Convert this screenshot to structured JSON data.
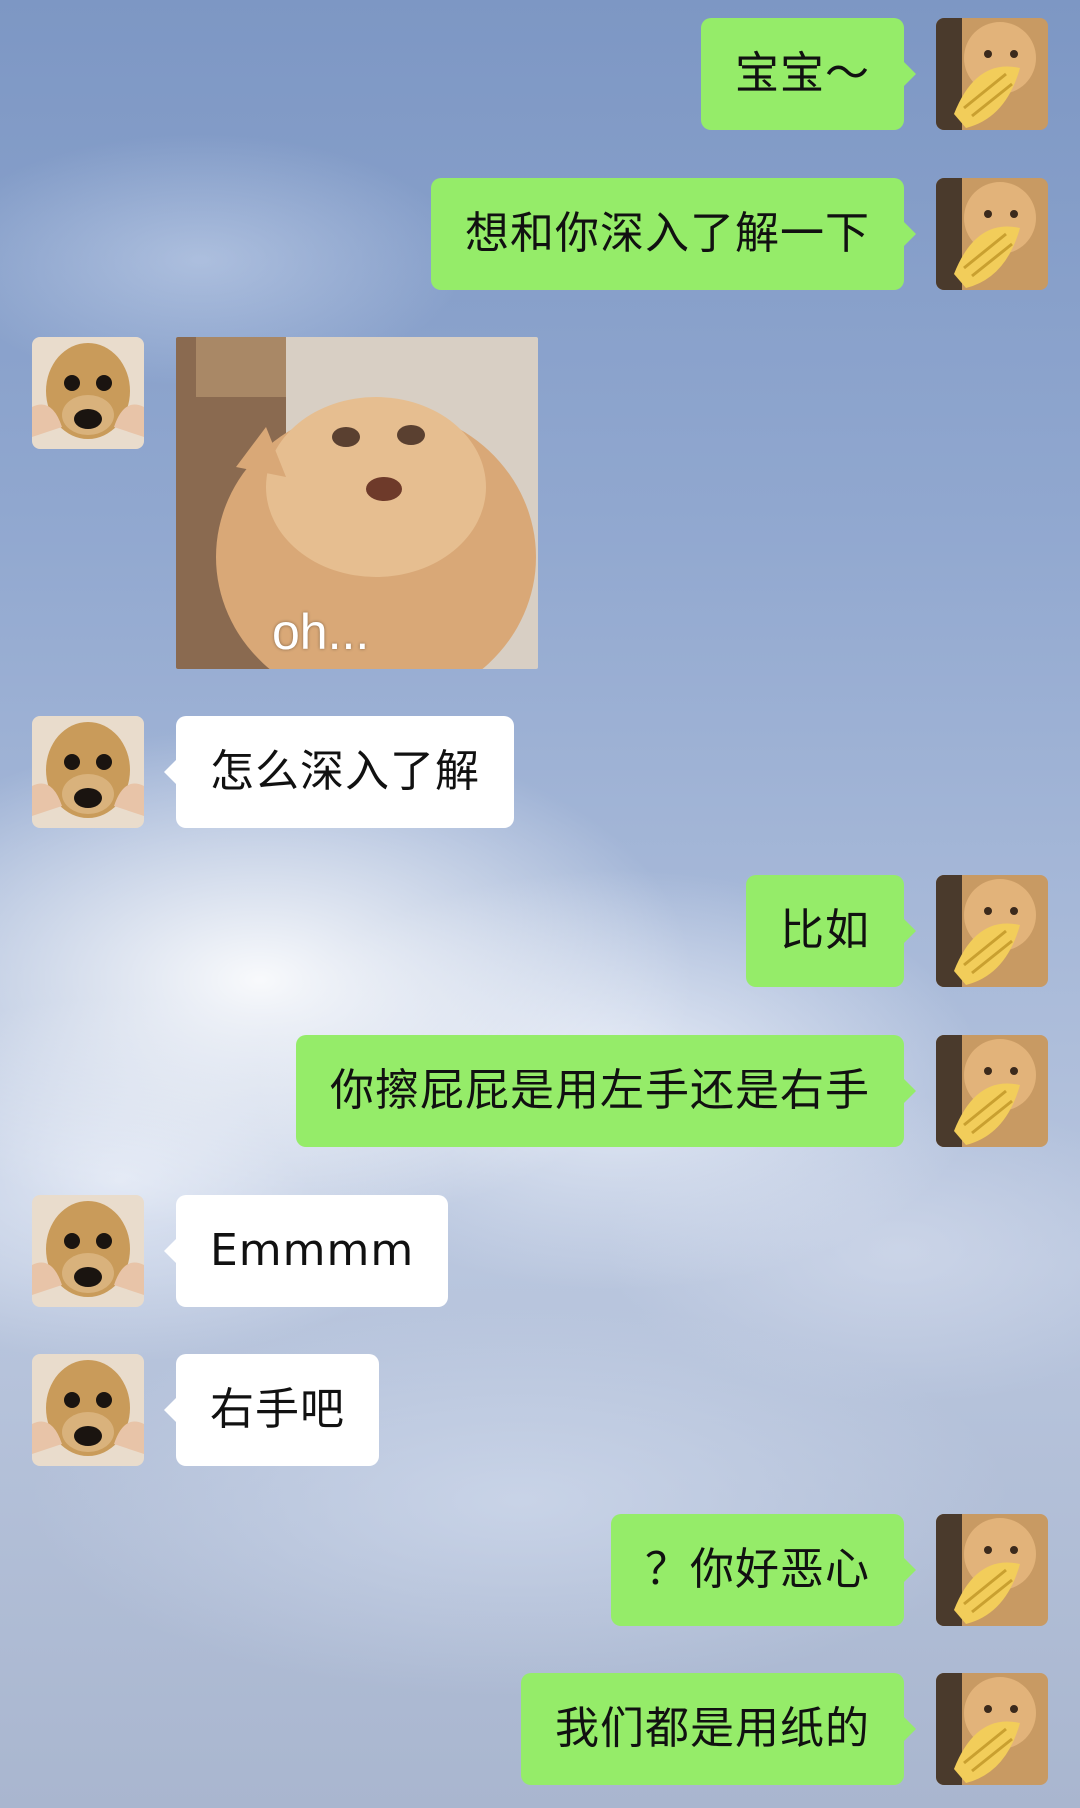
{
  "messages": [
    {
      "side": "sent",
      "text": "宝宝～"
    },
    {
      "side": "sent",
      "text": "想和你深入了解一下"
    },
    {
      "side": "recv",
      "sticker_caption": "oh..."
    },
    {
      "side": "recv",
      "text": "怎么深入了解"
    },
    {
      "side": "sent",
      "text": "比如"
    },
    {
      "side": "sent",
      "text": "你擦屁屁是用左手还是右手"
    },
    {
      "side": "recv",
      "text": "Emmmm"
    },
    {
      "side": "recv",
      "text": "右手吧"
    },
    {
      "side": "sent",
      "text": "？你好恶心"
    },
    {
      "side": "sent",
      "text": "我们都是用纸的"
    }
  ],
  "avatars": {
    "self": "orange-cat-avatar",
    "other": "puppy-avatar"
  },
  "colors": {
    "sent_bubble": "#95ec69",
    "received_bubble": "#ffffff"
  }
}
